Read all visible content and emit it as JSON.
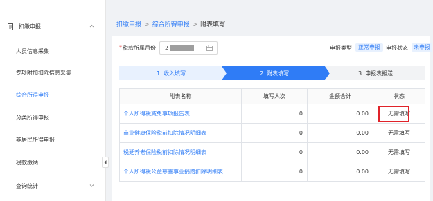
{
  "sidebar": {
    "section_title": "扣缴申报",
    "items": [
      {
        "label": "人员信息采集"
      },
      {
        "label": "专项附加扣除信息采集"
      },
      {
        "label": "综合所得申报"
      },
      {
        "label": "分类所得申报"
      },
      {
        "label": "非居民所得申报"
      },
      {
        "label": "税款缴纳"
      },
      {
        "label": "查询统计"
      }
    ],
    "active_index": 2
  },
  "breadcrumb": [
    {
      "label": "扣缴申报"
    },
    {
      "label": "综合所得申报"
    },
    {
      "label": "附表填写"
    }
  ],
  "form": {
    "required_mark": "*",
    "period_label": "税款所属月份",
    "period_value": "2",
    "decl_type_label": "申报类型",
    "decl_type_value": "正常申报",
    "decl_status_label": "申报状态",
    "decl_status_value": "未申报"
  },
  "steps": [
    {
      "label": "1. 收入填写"
    },
    {
      "label": "2. 附表填写"
    },
    {
      "label": "3. 申报表报送"
    }
  ],
  "active_step": 1,
  "table": {
    "headers": [
      "附表名称",
      "填写人次",
      "金额合计",
      "状态"
    ],
    "rows": [
      {
        "name": "个人所得税减免事项报告表",
        "count": "0",
        "amount": "0.00",
        "status": "无需填写"
      },
      {
        "name": "商业健康保险税前扣除情况明细表",
        "count": "0",
        "amount": "0.00",
        "status": "无需填写"
      },
      {
        "name": "税延养老保险税前扣除情况明细表",
        "count": "0",
        "amount": "0.00",
        "status": "无需填写"
      },
      {
        "name": "个人所得税公益慈善事业捐赠扣除明细表",
        "count": "0",
        "amount": "0.00",
        "status": "无需填写"
      }
    ]
  },
  "colors": {
    "accent": "#2f7cf6",
    "step_inactive": "#e8f1fe",
    "step_future": "#f2f3f5",
    "highlight": "#e0232a"
  },
  "icons": {
    "section": "document-icon",
    "expand": "chevron-up-icon",
    "collapse_sidebar": "chevron-left-icon",
    "calendar": "calendar-icon"
  }
}
